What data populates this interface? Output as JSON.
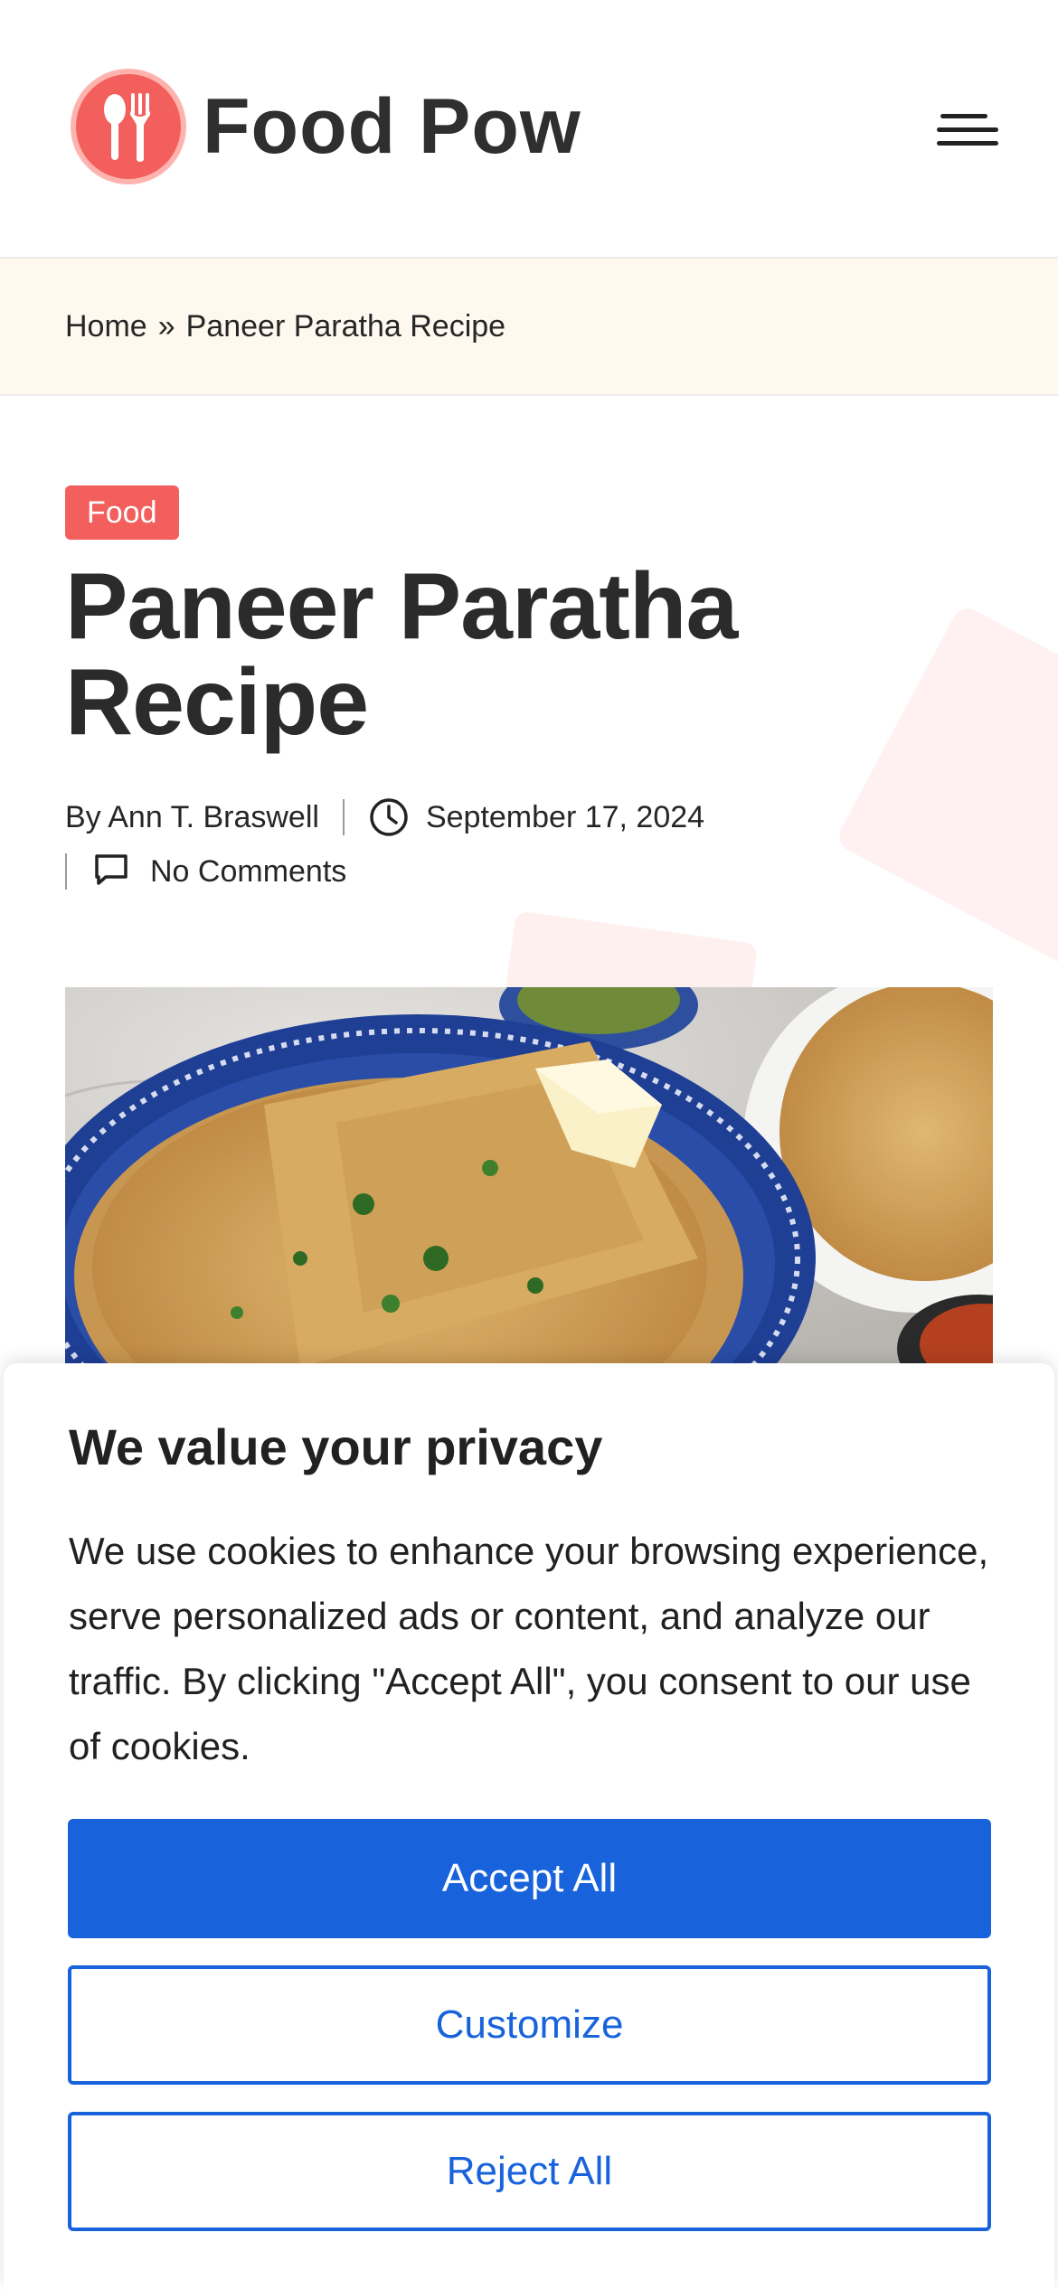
{
  "header": {
    "logo_text": "Food Pow",
    "menu_icon": "hamburger-menu-icon"
  },
  "breadcrumb": {
    "home": "Home",
    "separator": "»",
    "current": "Paneer Paratha Recipe"
  },
  "article": {
    "category": "Food",
    "title": "Paneer Paratha Recipe",
    "author": "By Ann T. Braswell",
    "date": "September 17, 2024",
    "comments": "No Comments",
    "image_icon": "featured-photo"
  },
  "cookie_banner": {
    "title": "We value your privacy",
    "body": "We use cookies to enhance your browsing experience, serve personalized ads or content, and analyze our traffic. By clicking \"Accept All\", you consent to our use of cookies.",
    "accept_label": "Accept All",
    "customize_label": "Customize",
    "reject_label": "Reject All"
  },
  "colors": {
    "brand": "#f25f5c",
    "cookie_button": "#1863dc",
    "breadcrumb_bg": "#fff8ef"
  }
}
